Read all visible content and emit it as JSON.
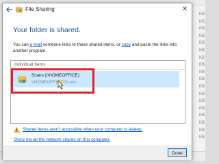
{
  "background": {
    "file_sizes": [
      "KB",
      "KB",
      "KB",
      "KB",
      "KB",
      "KB",
      "KB",
      "KB",
      "KB",
      "KB",
      "KB",
      "KB",
      "KB",
      "KB",
      "KB",
      "KB",
      "KB",
      "KB"
    ]
  },
  "dialog": {
    "title": "File Sharing",
    "close_glyph": "✕",
    "heading": "Your folder is shared.",
    "description": {
      "part1": "You can ",
      "email_link": "e-mail",
      "part2": " someone links to these shared items, or ",
      "copy_link": "copy",
      "part3": " and paste the links into another program."
    },
    "list": {
      "header": "Individual Items",
      "items": [
        {
          "name": "Scans (\\\\HOMEOFFICE)",
          "path": "\\\\HOMEOFFICE\\Scans"
        }
      ]
    },
    "warning_link": "Shared items aren't accessible when your computer is asleep.",
    "network_link": "Show me all the network shares on this computer.",
    "done_label": "Done"
  },
  "colors": {
    "heading": "#1e4f9b",
    "link": "#0a58c2",
    "selection": "#cce8ff",
    "highlight_box": "#e0202a",
    "button_border": "#0078d7"
  }
}
